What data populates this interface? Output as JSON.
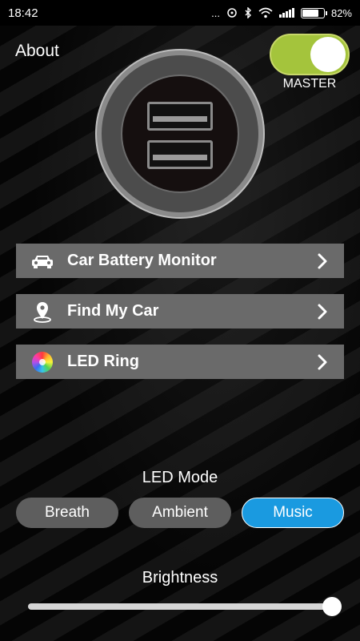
{
  "status_bar": {
    "time": "18:42",
    "dots": "...",
    "battery_percent": "82%",
    "battery_level": 0.82
  },
  "header": {
    "about_label": "About",
    "master_label": "MASTER",
    "master_on": true,
    "toggle_color": "#a4c43c"
  },
  "menu": [
    {
      "label": "Car Battery Monitor",
      "icon": "car-icon"
    },
    {
      "label": "Find My Car",
      "icon": "location-pin-icon"
    },
    {
      "label": "LED Ring",
      "icon": "color-wheel-icon"
    }
  ],
  "led_mode": {
    "title": "LED Mode",
    "options": [
      "Breath",
      "Ambient",
      "Music"
    ],
    "selected": "Music",
    "active_color": "#1a9ae0"
  },
  "brightness": {
    "title": "Brightness",
    "value": 1.0
  }
}
